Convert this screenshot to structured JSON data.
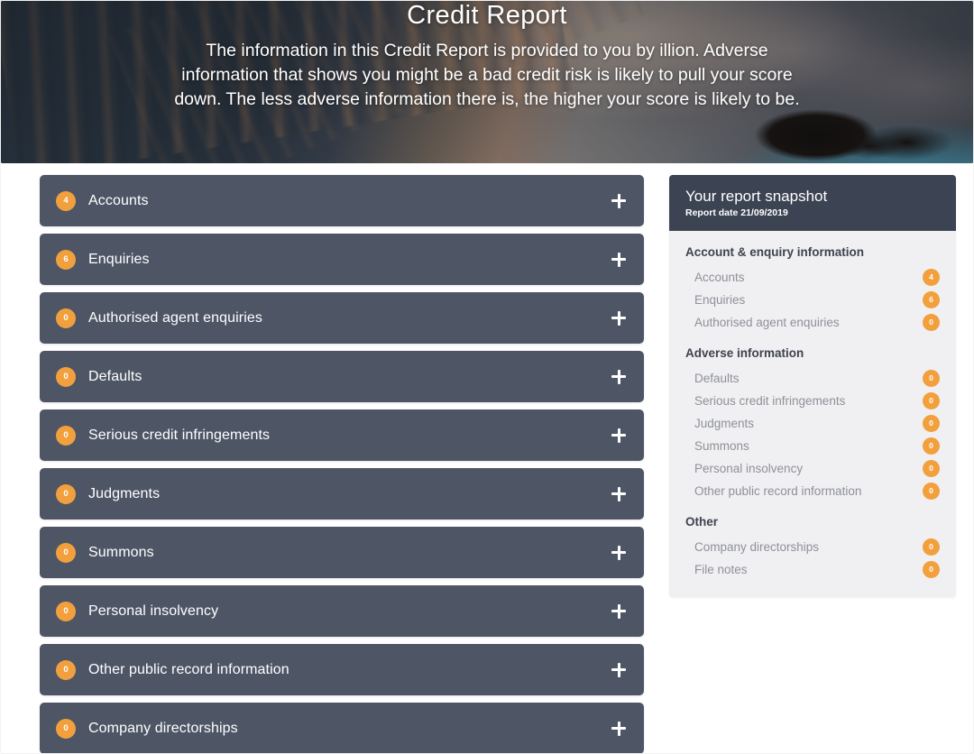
{
  "hero": {
    "title": "Credit Report",
    "description": "The information in this Credit Report is provided to you by illion. Adverse information that shows you might be a bad credit risk is likely to pull your score down. The less adverse information there is, the higher your score is likely to be."
  },
  "accordion": {
    "expand_icon": "plus-icon",
    "rows": [
      {
        "label": "Accounts",
        "count": "4"
      },
      {
        "label": "Enquiries",
        "count": "6"
      },
      {
        "label": "Authorised agent enquiries",
        "count": "0"
      },
      {
        "label": "Defaults",
        "count": "0"
      },
      {
        "label": "Serious credit infringements",
        "count": "0"
      },
      {
        "label": "Judgments",
        "count": "0"
      },
      {
        "label": "Summons",
        "count": "0"
      },
      {
        "label": "Personal insolvency",
        "count": "0"
      },
      {
        "label": "Other public record information",
        "count": "0"
      },
      {
        "label": "Company directorships",
        "count": "0"
      }
    ]
  },
  "snapshot": {
    "title": "Your report snapshot",
    "date_label": "Report date 21/09/2019",
    "sections": [
      {
        "title": "Account & enquiry information",
        "rows": [
          {
            "label": "Accounts",
            "count": "4"
          },
          {
            "label": "Enquiries",
            "count": "6"
          },
          {
            "label": "Authorised agent enquiries",
            "count": "0"
          }
        ]
      },
      {
        "title": "Adverse information",
        "rows": [
          {
            "label": "Defaults",
            "count": "0"
          },
          {
            "label": "Serious credit infringements",
            "count": "0"
          },
          {
            "label": "Judgments",
            "count": "0"
          },
          {
            "label": "Summons",
            "count": "0"
          },
          {
            "label": "Personal insolvency",
            "count": "0"
          },
          {
            "label": "Other public record information",
            "count": "0"
          }
        ]
      },
      {
        "title": "Other",
        "rows": [
          {
            "label": "Company directorships",
            "count": "0"
          },
          {
            "label": "File notes",
            "count": "0"
          }
        ]
      }
    ]
  },
  "colors": {
    "accent_orange": "#f2a03d",
    "row_slate": "#4e5666",
    "panel_header": "#3c4352",
    "panel_background": "#f0f0f2",
    "muted_text": "#8e9199"
  }
}
